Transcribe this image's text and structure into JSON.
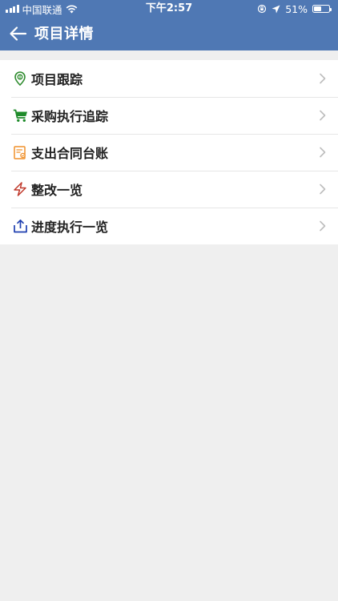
{
  "status_bar": {
    "carrier": "中国联通",
    "time": "下午2:57",
    "battery_percent": "51%",
    "battery_level": 0.51
  },
  "navbar": {
    "title": "项目详情",
    "back_icon": "arrow-left-icon"
  },
  "menu": {
    "items": [
      {
        "label": "项目跟踪",
        "icon": "location-pin-icon",
        "color": "#2e8b2e"
      },
      {
        "label": "采购执行追踪",
        "icon": "shopping-cart-icon",
        "color": "#1e8b2a"
      },
      {
        "label": "支出合同台账",
        "icon": "contract-icon",
        "color": "#f0902a"
      },
      {
        "label": "整改一览",
        "icon": "lightning-icon",
        "color": "#c0392b"
      },
      {
        "label": "进度执行一览",
        "icon": "upload-icon",
        "color": "#1f3fb0"
      }
    ]
  },
  "colors": {
    "header": "#4f78b4",
    "background": "#efefef"
  }
}
